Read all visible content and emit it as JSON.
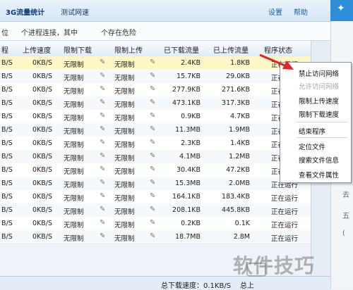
{
  "top": {
    "tab1": "3G流量统计",
    "tab2": "测试网速",
    "settings": "设置",
    "help": "帮助"
  },
  "info": {
    "p1": "位",
    "p2": "个进程连接，其中",
    "p3": "个存在危险"
  },
  "headers": [
    "程",
    "上传速度",
    "限制下载",
    "限制上传",
    "已下载流量",
    "已上传流量",
    "程序状态"
  ],
  "rows": [
    [
      "B/S",
      "0KB/S",
      "无限制",
      "无限制",
      "2.4KB",
      "1.8KB",
      "正在运行"
    ],
    [
      "B/S",
      "0KB/S",
      "无限制",
      "无限制",
      "15.7KB",
      "29.0KB",
      "正在运行"
    ],
    [
      "B/S",
      "0KB/S",
      "无限制",
      "无限制",
      "277.9KB",
      "271.6KB",
      "正在运行"
    ],
    [
      "B/S",
      "0KB/S",
      "无限制",
      "无限制",
      "473.1KB",
      "317.3KB",
      "正在运行"
    ],
    [
      "B/S",
      "0KB/S",
      "无限制",
      "无限制",
      "0.9KB",
      "4.7KB",
      "正在运行"
    ],
    [
      "B/S",
      "0KB/S",
      "无限制",
      "无限制",
      "11.3MB",
      "1.9MB",
      "正在运行"
    ],
    [
      "B/S",
      "0KB/S",
      "无限制",
      "无限制",
      "2.3KB",
      "1.4KB",
      "正在运行"
    ],
    [
      "B/S",
      "0KB/S",
      "无限制",
      "无限制",
      "4.1MB",
      "1.2MB",
      "正在运行"
    ],
    [
      "B/S",
      "0KB/S",
      "无限制",
      "无限制",
      "30.4KB",
      "47.2KB",
      "正在运行"
    ],
    [
      "B/S",
      "0KB/S",
      "无限制",
      "无限制",
      "15.3MB",
      "2.0MB",
      "正在运行"
    ],
    [
      "B/S",
      "0KB/S",
      "无限制",
      "无限制",
      "164.1KB",
      "183.4KB",
      "正在运行"
    ],
    [
      "B/S",
      "0KB/S",
      "无限制",
      "无限制",
      "208.1KB",
      "445.8KB",
      "正在运行"
    ],
    [
      "B/S",
      "0KB/S",
      "无限制",
      "无限制",
      "0.2KB",
      "0.1K",
      "正在运行"
    ],
    [
      "B/S",
      "0KB/S",
      "无限制",
      "无限制",
      "18.7MB",
      "2.8M",
      "正在运行"
    ]
  ],
  "menu": [
    "禁止访问网络",
    "允许访问网络",
    "限制上传速度",
    "限制下载速度",
    "结束程序",
    "定位文件",
    "搜索文件信息",
    "查看文件属性"
  ],
  "right_pane": [
    "去",
    "五",
    "("
  ],
  "status": {
    "total_download": "总下载速度：0.1KB/S",
    "total_upload": "总上"
  },
  "watermark": "软件技巧"
}
